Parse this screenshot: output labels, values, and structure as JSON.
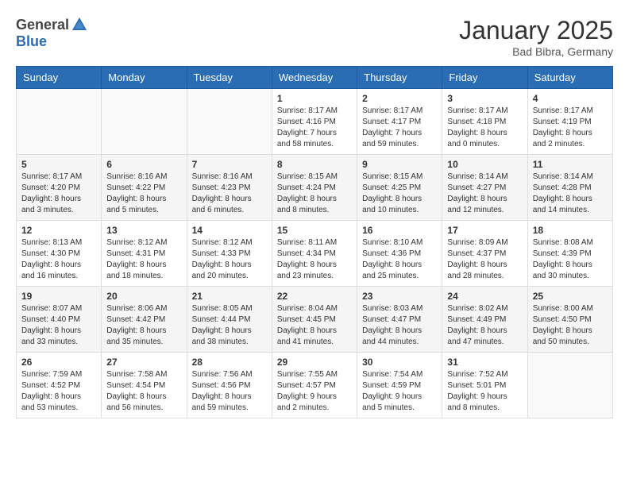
{
  "header": {
    "logo_general": "General",
    "logo_blue": "Blue",
    "month": "January 2025",
    "location": "Bad Bibra, Germany"
  },
  "weekdays": [
    "Sunday",
    "Monday",
    "Tuesday",
    "Wednesday",
    "Thursday",
    "Friday",
    "Saturday"
  ],
  "weeks": [
    {
      "days": [
        {
          "num": "",
          "info": ""
        },
        {
          "num": "",
          "info": ""
        },
        {
          "num": "",
          "info": ""
        },
        {
          "num": "1",
          "info": "Sunrise: 8:17 AM\nSunset: 4:16 PM\nDaylight: 7 hours and 58 minutes."
        },
        {
          "num": "2",
          "info": "Sunrise: 8:17 AM\nSunset: 4:17 PM\nDaylight: 7 hours and 59 minutes."
        },
        {
          "num": "3",
          "info": "Sunrise: 8:17 AM\nSunset: 4:18 PM\nDaylight: 8 hours and 0 minutes."
        },
        {
          "num": "4",
          "info": "Sunrise: 8:17 AM\nSunset: 4:19 PM\nDaylight: 8 hours and 2 minutes."
        }
      ]
    },
    {
      "days": [
        {
          "num": "5",
          "info": "Sunrise: 8:17 AM\nSunset: 4:20 PM\nDaylight: 8 hours and 3 minutes."
        },
        {
          "num": "6",
          "info": "Sunrise: 8:16 AM\nSunset: 4:22 PM\nDaylight: 8 hours and 5 minutes."
        },
        {
          "num": "7",
          "info": "Sunrise: 8:16 AM\nSunset: 4:23 PM\nDaylight: 8 hours and 6 minutes."
        },
        {
          "num": "8",
          "info": "Sunrise: 8:15 AM\nSunset: 4:24 PM\nDaylight: 8 hours and 8 minutes."
        },
        {
          "num": "9",
          "info": "Sunrise: 8:15 AM\nSunset: 4:25 PM\nDaylight: 8 hours and 10 minutes."
        },
        {
          "num": "10",
          "info": "Sunrise: 8:14 AM\nSunset: 4:27 PM\nDaylight: 8 hours and 12 minutes."
        },
        {
          "num": "11",
          "info": "Sunrise: 8:14 AM\nSunset: 4:28 PM\nDaylight: 8 hours and 14 minutes."
        }
      ]
    },
    {
      "days": [
        {
          "num": "12",
          "info": "Sunrise: 8:13 AM\nSunset: 4:30 PM\nDaylight: 8 hours and 16 minutes."
        },
        {
          "num": "13",
          "info": "Sunrise: 8:12 AM\nSunset: 4:31 PM\nDaylight: 8 hours and 18 minutes."
        },
        {
          "num": "14",
          "info": "Sunrise: 8:12 AM\nSunset: 4:33 PM\nDaylight: 8 hours and 20 minutes."
        },
        {
          "num": "15",
          "info": "Sunrise: 8:11 AM\nSunset: 4:34 PM\nDaylight: 8 hours and 23 minutes."
        },
        {
          "num": "16",
          "info": "Sunrise: 8:10 AM\nSunset: 4:36 PM\nDaylight: 8 hours and 25 minutes."
        },
        {
          "num": "17",
          "info": "Sunrise: 8:09 AM\nSunset: 4:37 PM\nDaylight: 8 hours and 28 minutes."
        },
        {
          "num": "18",
          "info": "Sunrise: 8:08 AM\nSunset: 4:39 PM\nDaylight: 8 hours and 30 minutes."
        }
      ]
    },
    {
      "days": [
        {
          "num": "19",
          "info": "Sunrise: 8:07 AM\nSunset: 4:40 PM\nDaylight: 8 hours and 33 minutes."
        },
        {
          "num": "20",
          "info": "Sunrise: 8:06 AM\nSunset: 4:42 PM\nDaylight: 8 hours and 35 minutes."
        },
        {
          "num": "21",
          "info": "Sunrise: 8:05 AM\nSunset: 4:44 PM\nDaylight: 8 hours and 38 minutes."
        },
        {
          "num": "22",
          "info": "Sunrise: 8:04 AM\nSunset: 4:45 PM\nDaylight: 8 hours and 41 minutes."
        },
        {
          "num": "23",
          "info": "Sunrise: 8:03 AM\nSunset: 4:47 PM\nDaylight: 8 hours and 44 minutes."
        },
        {
          "num": "24",
          "info": "Sunrise: 8:02 AM\nSunset: 4:49 PM\nDaylight: 8 hours and 47 minutes."
        },
        {
          "num": "25",
          "info": "Sunrise: 8:00 AM\nSunset: 4:50 PM\nDaylight: 8 hours and 50 minutes."
        }
      ]
    },
    {
      "days": [
        {
          "num": "26",
          "info": "Sunrise: 7:59 AM\nSunset: 4:52 PM\nDaylight: 8 hours and 53 minutes."
        },
        {
          "num": "27",
          "info": "Sunrise: 7:58 AM\nSunset: 4:54 PM\nDaylight: 8 hours and 56 minutes."
        },
        {
          "num": "28",
          "info": "Sunrise: 7:56 AM\nSunset: 4:56 PM\nDaylight: 8 hours and 59 minutes."
        },
        {
          "num": "29",
          "info": "Sunrise: 7:55 AM\nSunset: 4:57 PM\nDaylight: 9 hours and 2 minutes."
        },
        {
          "num": "30",
          "info": "Sunrise: 7:54 AM\nSunset: 4:59 PM\nDaylight: 9 hours and 5 minutes."
        },
        {
          "num": "31",
          "info": "Sunrise: 7:52 AM\nSunset: 5:01 PM\nDaylight: 9 hours and 8 minutes."
        },
        {
          "num": "",
          "info": ""
        }
      ]
    }
  ]
}
